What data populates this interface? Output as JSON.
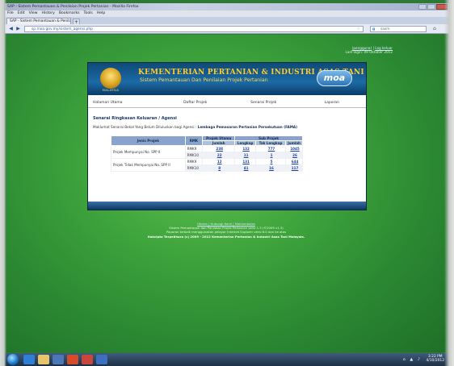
{
  "browser": {
    "title": "SAP - Sistem Pemantauan & Penilaian Projek Pertanian - Mozilla Firefox",
    "menu": [
      "File",
      "Edit",
      "View",
      "History",
      "Bookmarks",
      "Tools",
      "Help"
    ],
    "tab_label": "SAP - Sistem Pemantauan & Penilaian P...",
    "url": "sp.moa.gov.my/sistem_agensi.php",
    "search_engine": "g",
    "search_placeholder": "sasm"
  },
  "header": {
    "user_link": "(pengguna)",
    "logout_link": "Log keluar",
    "last_login": "Last login: 09 Oktober 2012"
  },
  "banner": {
    "crest_label": "MALAYSIA",
    "ministry": "KEMENTERIAN PERTANIAN & INDUSTRI ASAS TANI",
    "system_name": "Sistem Pemantauan Dan Penilaian Projek Pertanian",
    "logo": "moa"
  },
  "nav": {
    "items": [
      "Halaman Utama",
      "Daftar Projek",
      "Senarai Projek",
      "Laporan"
    ]
  },
  "content": {
    "heading": "Senarai Ringkasan Keluaran / Agensi",
    "subline_prefix": "Maklumat Senarai Bekal Yang Belum Diluluskan bagi Agensi :",
    "agency": "Lembaga Pemasaran Pertanian Persekutuan (FAMA)",
    "table": {
      "headers": {
        "col1": "Jenis Projek",
        "col2": "RMK",
        "group1": "Projek Utama",
        "group2": "Sub Projek",
        "sub1": "Jumlah",
        "sub2": "Lengkap",
        "sub3": "Tak Lengkap",
        "sub4": "Jumlah"
      },
      "rows": [
        {
          "jenis": "Projek Mempunyai No. SPP II",
          "rmk": "RMK9",
          "utama": "238",
          "lengkap": "132",
          "tak": "777",
          "jumlah": "1045"
        },
        {
          "jenis": "",
          "rmk": "RMK10",
          "utama": "22",
          "lengkap": "11",
          "tak": "1",
          "jumlah": "26"
        },
        {
          "jenis": "Projek Tidak Mempunyai No. SPP II",
          "rmk": "RMK9",
          "utama": "12",
          "lengkap": "131",
          "tak": "5",
          "jumlah": "644"
        },
        {
          "jenis": "",
          "rmk": "RMK10",
          "utama": "8",
          "lengkap": "41",
          "tak": "16",
          "jumlah": "117"
        }
      ]
    }
  },
  "footer": {
    "links": "Utama | Hubungi Kami | Maklumbalas",
    "line1": "Sistem Pemantauan dan Penilaian Projek Pertanian versi 1.3 (©2009 v1.3)",
    "line2": "Paparan terbaik menggunakan pelayar Internet Explorer versi 6.0 dan ke atas",
    "copyright": "Hakcipta Terpelihara (c) 2009 - 2012 Kementerian Pertanian & Industri Asas Tani Malaysia."
  },
  "taskbar": {
    "time": "3:22 PM",
    "date": "4/10/2012"
  }
}
